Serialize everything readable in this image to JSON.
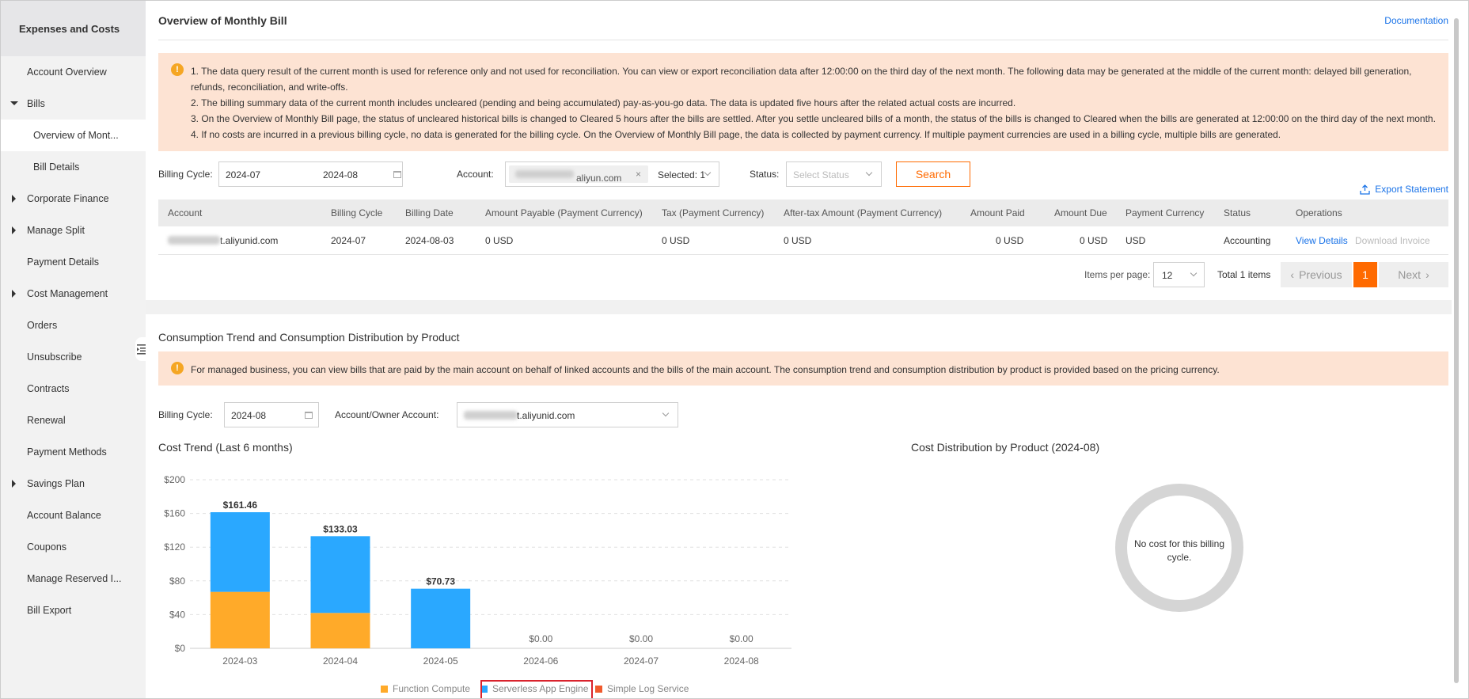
{
  "sidebar": {
    "title": "Expenses and Costs",
    "items": [
      {
        "label": "Account Overview"
      },
      {
        "label": "Bills"
      },
      {
        "label": "Overview of Mont..."
      },
      {
        "label": "Bill Details"
      },
      {
        "label": "Corporate Finance"
      },
      {
        "label": "Manage Split"
      },
      {
        "label": "Payment Details"
      },
      {
        "label": "Cost Management"
      },
      {
        "label": "Orders"
      },
      {
        "label": "Unsubscribe"
      },
      {
        "label": "Contracts"
      },
      {
        "label": "Renewal"
      },
      {
        "label": "Payment Methods"
      },
      {
        "label": "Savings Plan"
      },
      {
        "label": "Account Balance"
      },
      {
        "label": "Coupons"
      },
      {
        "label": "Manage Reserved I..."
      },
      {
        "label": "Bill Export"
      }
    ]
  },
  "header": {
    "title": "Overview of Monthly Bill",
    "doc_link": "Documentation"
  },
  "notice1": {
    "lines": [
      "1. The data query result of the current month is used for reference only and not used for reconciliation. You can view or export reconciliation data after 12:00:00 on the third day of the next month. The following data may be generated at the middle of the current month: delayed bill generation, refunds, reconciliation, and write-offs.",
      "2. The billing summary data of the current month includes uncleared (pending and being accumulated) pay-as-you-go data. The data is updated five hours after the related actual costs are incurred.",
      "3. On the Overview of Monthly Bill page, the status of uncleared historical bills is changed to Cleared 5 hours after the bills are settled. After you settle uncleared bills of a month, the status of the bills is changed to Cleared when the bills are generated at 12:00:00 on the third day of the next month.",
      "4. If no costs are incurred in a previous billing cycle, no data is generated for the billing cycle. On the Overview of Monthly Bill page, the data is collected by payment currency. If multiple payment currencies are used in a billing cycle, multiple bills are generated."
    ]
  },
  "filters": {
    "billing_cycle_label": "Billing Cycle:",
    "cycle_start": "2024-07",
    "cycle_end": "2024-08",
    "account_label": "Account:",
    "account_chip": "aliyun.com",
    "chip_close": "×",
    "selected": "Selected: 1",
    "status_label": "Status:",
    "status_placeholder": "Select Status",
    "search_button": "Search",
    "export": "Export Statement"
  },
  "table": {
    "headers": [
      "Account",
      "Billing Cycle",
      "Billing Date",
      "Amount Payable (Payment Currency)",
      "Tax (Payment Currency)",
      "After-tax Amount (Payment Currency)",
      "Amount Paid",
      "Amount Due",
      "Payment Currency",
      "Status",
      "Operations"
    ],
    "row": {
      "account": "t.aliyunid.com",
      "billing_cycle": "2024-07",
      "billing_date": "2024-08-03",
      "amount_payable": "0 USD",
      "tax": "0 USD",
      "after_tax": "0 USD",
      "amount_paid": "0 USD",
      "amount_due": "0 USD",
      "currency": "USD",
      "status": "Accounting",
      "view_details": "View Details",
      "download_invoice": "Download Invoice"
    }
  },
  "pagination": {
    "items_per_page_label": "Items per page:",
    "page_size": "12",
    "total": "Total 1 items",
    "previous": "Previous",
    "current": "1",
    "next": "Next"
  },
  "section2": {
    "title": "Consumption Trend and Consumption Distribution by Product",
    "notice": "For managed business, you can view bills that are paid by the main account on behalf of linked accounts and the bills of the main account. The consumption trend and consumption distribution by product is provided based on the pricing currency.",
    "billing_cycle_label": "Billing Cycle:",
    "billing_cycle_value": "2024-08",
    "account_owner_label": "Account/Owner Account:",
    "account_owner_value": "t.aliyunid.com",
    "trend_title": "Cost Trend (Last 6 months)",
    "distribution_title": "Cost Distribution by Product (2024-08)",
    "no_cost_text": "No cost for this billing cycle."
  },
  "chart_data": {
    "type": "bar",
    "stacked": true,
    "title": "Cost Trend (Last 6 months)",
    "categories": [
      "2024-03",
      "2024-04",
      "2024-05",
      "2024-06",
      "2024-07",
      "2024-08"
    ],
    "totals": [
      "$161.46",
      "$133.03",
      "$70.73",
      "$0.00",
      "$0.00",
      "$0.00"
    ],
    "series": [
      {
        "name": "Function Compute",
        "color": "#ffaa29",
        "values": [
          67,
          42,
          0,
          0,
          0,
          0
        ]
      },
      {
        "name": "Serverless App Engine",
        "color": "#2aa8ff",
        "values": [
          94.46,
          91.03,
          70.73,
          0,
          0,
          0
        ]
      },
      {
        "name": "Simple Log Service",
        "color": "#f05a2d",
        "values": [
          0,
          0,
          0,
          0,
          0,
          0
        ]
      }
    ],
    "y_ticks": [
      "$0",
      "$40",
      "$80",
      "$120",
      "$160",
      "$200"
    ],
    "ylim": [
      0,
      200
    ],
    "grid": true,
    "legend": "bottom"
  }
}
